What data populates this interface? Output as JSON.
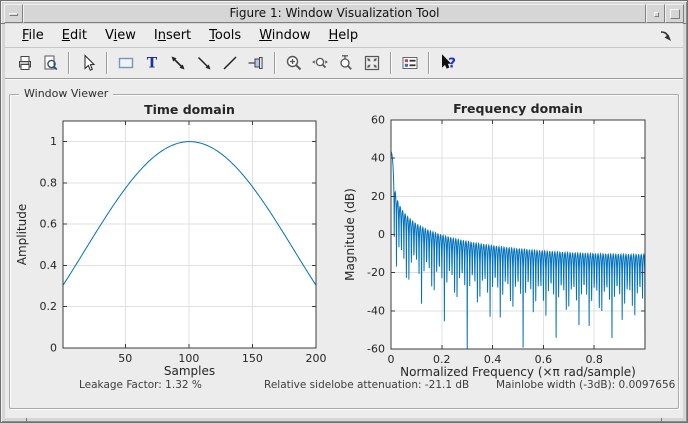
{
  "titlebar": {
    "title": "Figure 1: Window Visualization Tool"
  },
  "menubar": {
    "items": [
      {
        "label": "File",
        "underline_index": 0
      },
      {
        "label": "Edit",
        "underline_index": 0
      },
      {
        "label": "View",
        "underline_index": 1
      },
      {
        "label": "Insert",
        "underline_index": 1
      },
      {
        "label": "Tools",
        "underline_index": 0
      },
      {
        "label": "Window",
        "underline_index": 0
      },
      {
        "label": "Help",
        "underline_index": 0
      }
    ]
  },
  "toolbar": {
    "groups": [
      [
        "print",
        "print-preview"
      ],
      [
        "pointer"
      ],
      [
        "rectangle",
        "text",
        "double-arrow",
        "arrow",
        "line",
        "pin"
      ],
      [
        "zoom-in",
        "zoom-x",
        "zoom-y",
        "fit-view"
      ],
      [
        "legend"
      ],
      [
        "help-pointer"
      ]
    ]
  },
  "viewer": {
    "label": "Window Viewer",
    "stats": [
      {
        "id": "leakage",
        "text": "Leakage Factor: 1.32 %"
      },
      {
        "id": "sidelobe",
        "text": "Relative sidelobe attenuation: -21.1 dB"
      },
      {
        "id": "mainlobe",
        "text": "Mainlobe width (-3dB): 0.0097656"
      }
    ]
  },
  "chart_data": [
    {
      "type": "line",
      "title": "Time domain",
      "xlabel": "Samples",
      "ylabel": "Amplitude",
      "xlim": [
        1,
        200
      ],
      "ylim": [
        0,
        1.1
      ],
      "xticks": [
        50,
        100,
        150,
        200
      ],
      "yticks": [
        0,
        0.2,
        0.4,
        0.6,
        0.8,
        1
      ],
      "grid": true,
      "legend_position": "none",
      "line_color": "#0072BD",
      "series": [
        {
          "name": "window-samples",
          "generator": {
            "kind": "kaiser-window",
            "length": 200,
            "beta": 2.5
          },
          "first_value": 0.3,
          "peak": {
            "x": 100.5,
            "y": 1.0
          },
          "last_value": 0.3
        }
      ]
    },
    {
      "type": "line",
      "title": "Frequency domain",
      "xlabel": "Normalized Frequency  (×π rad/sample)",
      "ylabel": "Magnitude (dB)",
      "xlim": [
        0,
        1
      ],
      "ylim": [
        -60,
        60
      ],
      "xticks": [
        0,
        0.2,
        0.4,
        0.6,
        0.8
      ],
      "yticks": [
        -60,
        -40,
        -20,
        0,
        20,
        40,
        60
      ],
      "grid": true,
      "legend_position": "none",
      "line_color": "#0072BD",
      "series": [
        {
          "name": "magnitude-dB",
          "generator": {
            "kind": "kaiser-window-dft",
            "length": 200,
            "beta": 2.5,
            "points": 1024
          },
          "mainlobe_peak_dB": 43,
          "first_sidelobe_dB": 21.5
        }
      ]
    }
  ]
}
